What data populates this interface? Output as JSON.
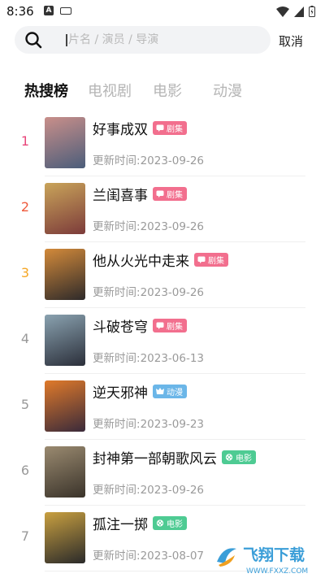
{
  "status_bar": {
    "time": "8:36",
    "notification_letter": "A"
  },
  "search": {
    "placeholder": "片名 / 演员 / 导演",
    "value": "",
    "cancel_label": "取消"
  },
  "tabs": [
    {
      "label": "热搜榜",
      "active": true
    },
    {
      "label": "电视剧",
      "active": false
    },
    {
      "label": "电影",
      "active": false
    },
    {
      "label": "动漫",
      "active": false
    }
  ],
  "update_prefix": "更新时间:",
  "items": [
    {
      "rank": "1",
      "rank_color": "#e8467a",
      "title": "好事成双",
      "tag": "剧集",
      "tag_icon": "tv-icon",
      "tag_color": "#f26f8e",
      "date": "2023-09-26",
      "poster_colors": [
        "#c98f8a",
        "#4b5d7a"
      ]
    },
    {
      "rank": "2",
      "rank_color": "#ef5a3c",
      "title": "兰闺喜事",
      "tag": "剧集",
      "tag_icon": "tv-icon",
      "tag_color": "#f26f8e",
      "date": "2023-09-26",
      "poster_colors": [
        "#c9a45a",
        "#7c3b3a"
      ]
    },
    {
      "rank": "3",
      "rank_color": "#f5a623",
      "title": "他从火光中走来",
      "tag": "剧集",
      "tag_icon": "tv-icon",
      "tag_color": "#f26f8e",
      "date": "2023-09-26",
      "poster_colors": [
        "#d38a3a",
        "#2e2a2a"
      ]
    },
    {
      "rank": "4",
      "rank_color": "#999999",
      "title": "斗破苍穹",
      "tag": "剧集",
      "tag_icon": "tv-icon",
      "tag_color": "#f26f8e",
      "date": "2023-06-13",
      "poster_colors": [
        "#8aa2b0",
        "#2b2f3a"
      ]
    },
    {
      "rank": "5",
      "rank_color": "#999999",
      "title": "逆天邪神",
      "tag": "动漫",
      "tag_icon": "anime-icon",
      "tag_color": "#6bb6e8",
      "date": "2023-09-23",
      "poster_colors": [
        "#e07a2a",
        "#3a2a3a"
      ]
    },
    {
      "rank": "6",
      "rank_color": "#999999",
      "title": "封神第一部朝歌风云",
      "tag": "电影",
      "tag_icon": "film-icon",
      "tag_color": "#4ecb93",
      "date": "2023-09-26",
      "poster_colors": [
        "#9a8a70",
        "#3a332a"
      ]
    },
    {
      "rank": "7",
      "rank_color": "#999999",
      "title": "孤注一掷",
      "tag": "电影",
      "tag_icon": "film-icon",
      "tag_color": "#4ecb93",
      "date": "2023-08-07",
      "poster_colors": [
        "#c9a040",
        "#2a2a2a"
      ]
    }
  ],
  "watermark": {
    "text": "飞翔下载",
    "url": "WWW.FXXZ.COM"
  }
}
